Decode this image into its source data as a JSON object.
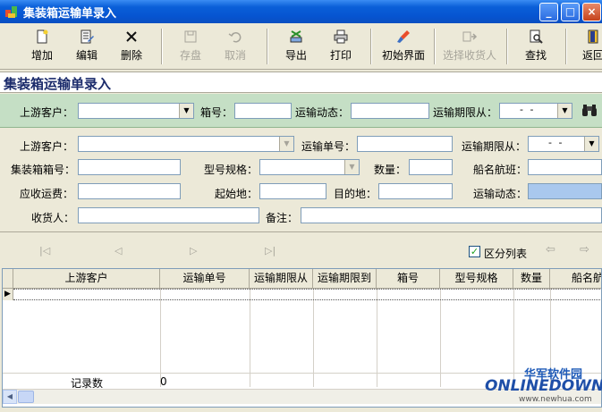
{
  "window": {
    "title": "集装箱运输单录入",
    "buttons": {
      "minimize": "_",
      "maximize": "□",
      "close": "×"
    }
  },
  "toolbar": {
    "items": [
      {
        "label": "增加",
        "icon": "add-document-icon",
        "enabled": true
      },
      {
        "label": "编辑",
        "icon": "edit-document-icon",
        "enabled": true
      },
      {
        "label": "删除",
        "icon": "delete-x-icon",
        "enabled": true
      },
      {
        "label": "存盘",
        "icon": "save-disk-icon",
        "enabled": false
      },
      {
        "label": "取消",
        "icon": "undo-icon",
        "enabled": false
      },
      {
        "label": "导出",
        "icon": "export-icon",
        "enabled": true
      },
      {
        "label": "打印",
        "icon": "printer-icon",
        "enabled": true
      },
      {
        "label": "初始界面",
        "icon": "brush-icon",
        "enabled": true
      },
      {
        "label": "选择收货人",
        "icon": "select-receiver-icon",
        "enabled": false
      },
      {
        "label": "查找",
        "icon": "find-icon",
        "enabled": true
      },
      {
        "label": "返回",
        "icon": "exit-door-icon",
        "enabled": true
      }
    ]
  },
  "heading": "集装箱运输单录入",
  "search": {
    "upstream_label": "上游客户：",
    "box_no_label": "箱号：",
    "status_label": "运输动态：",
    "period_label": "运输期限从：",
    "date_placeholder": "- -",
    "upstream_value": "",
    "box_no_value": "",
    "status_value": ""
  },
  "form": {
    "upstream_label": "上游客户：",
    "waybill_label": "运输单号：",
    "period_from_label": "运输期限从：",
    "container_no_label": "集装箱箱号：",
    "model_label": "型号规格：",
    "qty_label": "数量：",
    "ship_label": "船名航班：",
    "fee_label": "应收运费：",
    "origin_label": "起始地：",
    "dest_label": "目的地：",
    "status_label": "运输动态：",
    "receiver_label": "收货人：",
    "remark_label": "备注：",
    "date_placeholder": "- -"
  },
  "nav": {
    "first": "|◁",
    "prev": "◁",
    "next": "▷",
    "last": "▷|",
    "split_list_label": "区分列表",
    "split_list_checked": "✓",
    "back": "⇦",
    "forward": "⇨"
  },
  "grid": {
    "columns": [
      "上游客户",
      "运输单号",
      "运输期限从",
      "运输期限到",
      "箱号",
      "型号规格",
      "数量",
      "船名航"
    ],
    "footer_label": "记录数",
    "footer_count": "0"
  },
  "watermark": {
    "cn": "华军软件园",
    "en": "ONLINEDOWN",
    "url": "www.newhua.com"
  },
  "colors": {
    "titlebar": "#0654D1",
    "search_panel": "#C5DFC5",
    "status_field": "#A9C8EE",
    "heading_text": "#1B2B6B"
  }
}
